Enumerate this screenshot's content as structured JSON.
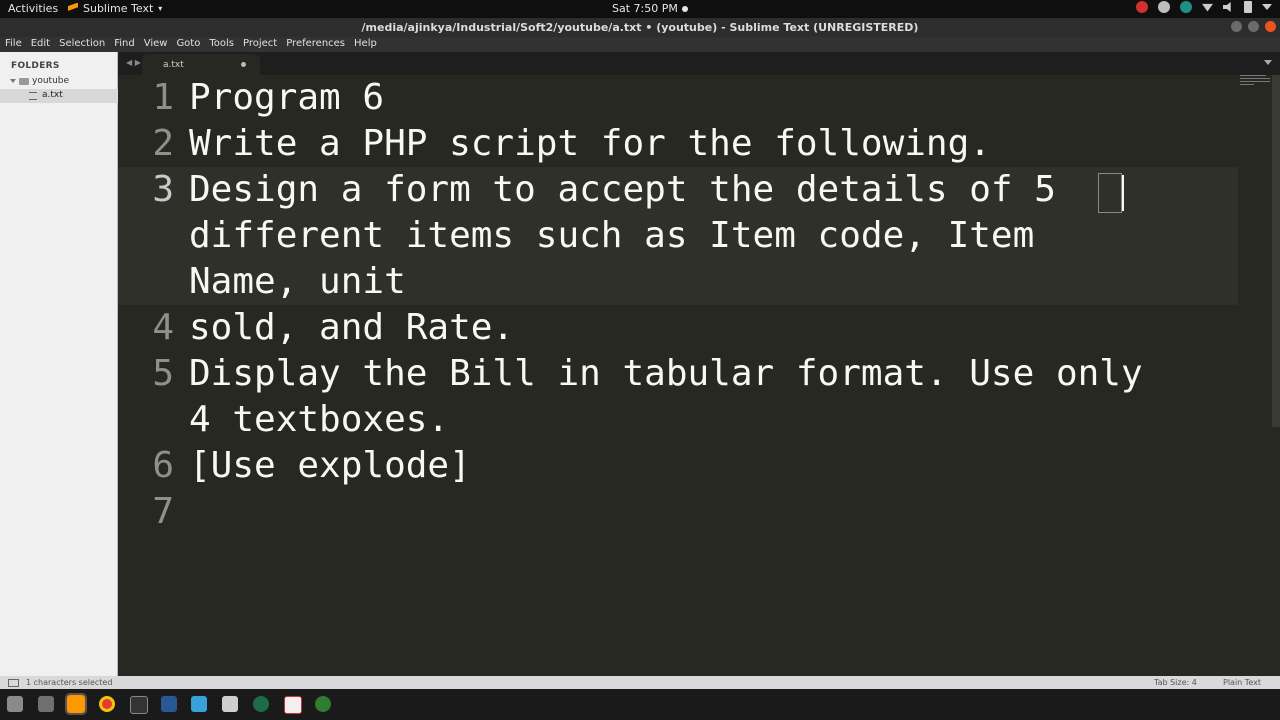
{
  "topbar": {
    "activities": "Activities",
    "app_name": "Sublime Text",
    "clock": "Sat  7:50 PM"
  },
  "window": {
    "title": "/media/ajinkya/Industrial/Soft2/youtube/a.txt • (youtube) - Sublime Text (UNREGISTERED)"
  },
  "menu": [
    "File",
    "Edit",
    "Selection",
    "Find",
    "View",
    "Goto",
    "Tools",
    "Project",
    "Preferences",
    "Help"
  ],
  "sidebar": {
    "heading": "FOLDERS",
    "folder": "youtube",
    "file": "a.txt"
  },
  "tab": {
    "name": "a.txt"
  },
  "editor": {
    "lines": [
      {
        "num": "1",
        "text": "Program 6"
      },
      {
        "num": "2",
        "text": "Write a PHP script for the following."
      },
      {
        "num": "3",
        "text": "Design a form to accept the details of 5"
      },
      {
        "num": "",
        "text": "different items such as Item code, Item"
      },
      {
        "num": "",
        "text": "Name, unit"
      },
      {
        "num": "4",
        "text": "sold, and Rate."
      },
      {
        "num": "5",
        "text": "Display the Bill in tabular format. Use only"
      },
      {
        "num": "",
        "text": "4 textboxes."
      },
      {
        "num": "6",
        "text": "[Use explode]"
      },
      {
        "num": "7",
        "text": ""
      }
    ]
  },
  "status": {
    "selection": "1 characters selected",
    "tab_size": "Tab Size: 4",
    "syntax": "Plain Text"
  },
  "colors": {
    "editor_bg": "#272822",
    "text": "#f8f8f2",
    "gutter": "#90908a",
    "sidebar_bg": "#f0f0f0",
    "sublime_orange": "#ff9800"
  }
}
